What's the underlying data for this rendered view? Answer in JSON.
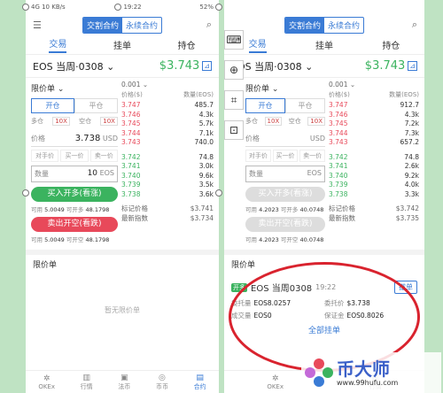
{
  "status": {
    "time": "19:22",
    "left": "4G 10 KB/s",
    "battery": "52%"
  },
  "segment": {
    "delivery": "交割合约",
    "perpetual": "永续合约"
  },
  "tabs": [
    "交易",
    "挂单",
    "持仓"
  ],
  "symbol": "EOS 当周·0308",
  "price": "$3.743",
  "form": {
    "order_type": "限价单",
    "open": "开仓",
    "close": "平仓",
    "long": "多仓",
    "short": "空仓",
    "lev": "10X",
    "price_label": "价格",
    "price_value": "3.738",
    "price_unit": "USD",
    "quick": [
      "对手价",
      "买一价",
      "卖一价"
    ],
    "qty_label": "数量",
    "qty_value": "10",
    "qty_unit": "EOS",
    "buy": "买入开多(看涨)",
    "sell": "卖出开空(看跌)",
    "avail_label": "可用",
    "avail_value": "5.0049",
    "can_open": "可开多",
    "can_open_short": "可开空",
    "can_value": "48.1798"
  },
  "book": {
    "depth": "0.001",
    "head_price": "价格($)",
    "head_qty": "数量(EOS)",
    "asks": [
      [
        "3.747",
        "485.7"
      ],
      [
        "3.746",
        "4.3k"
      ],
      [
        "3.745",
        "5.7k"
      ],
      [
        "3.744",
        "7.1k"
      ],
      [
        "3.743",
        "740.0"
      ]
    ],
    "bids": [
      [
        "3.742",
        "74.8"
      ],
      [
        "3.741",
        "3.0k"
      ],
      [
        "3.740",
        "9.6k"
      ],
      [
        "3.739",
        "3.5k"
      ],
      [
        "3.738",
        "3.6k"
      ]
    ],
    "mark_label": "标记价格",
    "mark_value": "$3.741",
    "index_label": "最新指数",
    "index_value": "$3.734"
  },
  "section_title": "限价单",
  "empty": "暂无限价单",
  "nav": [
    "OKEx",
    "行情",
    "法币",
    "币币",
    "合约"
  ],
  "right": {
    "price_value": "",
    "price_unit": "USD",
    "qty_value": "",
    "qty_unit": "EOS",
    "buy": "买入开多(看涨)",
    "sell": "卖出开空(看跌)",
    "avail1": "4.2023",
    "can1": "40.0748",
    "avail2": "4.2023",
    "can2": "40.0748",
    "asks": [
      [
        "3.747",
        "912.7"
      ],
      [
        "3.746",
        "4.3k"
      ],
      [
        "3.745",
        "7.2k"
      ],
      [
        "3.744",
        "7.3k"
      ],
      [
        "3.743",
        "657.2"
      ]
    ],
    "bids": [
      [
        "3.742",
        "74.8"
      ],
      [
        "3.741",
        "2.6k"
      ],
      [
        "3.740",
        "9.2k"
      ],
      [
        "3.739",
        "4.0k"
      ],
      [
        "3.738",
        "3.3k"
      ]
    ],
    "mark_value": "$3.742",
    "index_value": "$3.735",
    "order": {
      "tag": "开多",
      "symbol": "EOS 当周0308",
      "time": "19:22",
      "cancel": "撤单",
      "qty_label": "委托量",
      "qty": "EOS8.0257",
      "price_label": "委托价",
      "price": "$3.738",
      "deal_label": "成交量",
      "deal": "EOS0",
      "margin_label": "保证金",
      "margin": "EOS0.8026"
    },
    "all_orders": "全部挂单"
  },
  "watermark": {
    "brand": "币大师",
    "url": "www.99hufu.com"
  },
  "colors": {
    "accent": "#3a7bd5",
    "buy": "#3bb35f",
    "sell": "#e8495a",
    "annotation": "#d9232e"
  }
}
